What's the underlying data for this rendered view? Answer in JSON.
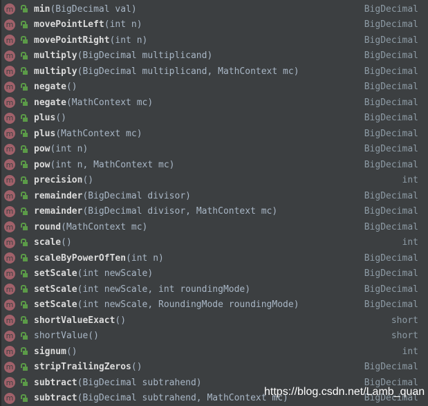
{
  "items": [
    {
      "name": "min",
      "params": "(BigDecimal val)",
      "ret": "BigDecimal"
    },
    {
      "name": "movePointLeft",
      "params": "(int n)",
      "ret": "BigDecimal"
    },
    {
      "name": "movePointRight",
      "params": "(int n)",
      "ret": "BigDecimal"
    },
    {
      "name": "multiply",
      "params": "(BigDecimal multiplicand)",
      "ret": "BigDecimal"
    },
    {
      "name": "multiply",
      "params": "(BigDecimal multiplicand, MathContext mc)",
      "ret": "BigDecimal"
    },
    {
      "name": "negate",
      "params": "()",
      "ret": "BigDecimal"
    },
    {
      "name": "negate",
      "params": "(MathContext mc)",
      "ret": "BigDecimal"
    },
    {
      "name": "plus",
      "params": "()",
      "ret": "BigDecimal"
    },
    {
      "name": "plus",
      "params": "(MathContext mc)",
      "ret": "BigDecimal"
    },
    {
      "name": "pow",
      "params": "(int n)",
      "ret": "BigDecimal"
    },
    {
      "name": "pow",
      "params": "(int n, MathContext mc)",
      "ret": "BigDecimal"
    },
    {
      "name": "precision",
      "params": "()",
      "ret": "int"
    },
    {
      "name": "remainder",
      "params": "(BigDecimal divisor)",
      "ret": "BigDecimal"
    },
    {
      "name": "remainder",
      "params": "(BigDecimal divisor, MathContext mc)",
      "ret": "BigDecimal"
    },
    {
      "name": "round",
      "params": "(MathContext mc)",
      "ret": "BigDecimal"
    },
    {
      "name": "scale",
      "params": "()",
      "ret": "int"
    },
    {
      "name": "scaleByPowerOfTen",
      "params": "(int n)",
      "ret": "BigDecimal"
    },
    {
      "name": "setScale",
      "params": "(int newScale)",
      "ret": "BigDecimal"
    },
    {
      "name": "setScale",
      "params": "(int newScale, int roundingMode)",
      "ret": "BigDecimal"
    },
    {
      "name": "setScale",
      "params": "(int newScale, RoundingMode roundingMode)",
      "ret": "BigDecimal"
    },
    {
      "name": "shortValueExact",
      "params": "()",
      "ret": "short"
    },
    {
      "name": "shortValue",
      "params": "()",
      "ret": "short",
      "plain": true
    },
    {
      "name": "signum",
      "params": "()",
      "ret": "int"
    },
    {
      "name": "stripTrailingZeros",
      "params": "()",
      "ret": "BigDecimal"
    },
    {
      "name": "subtract",
      "params": "(BigDecimal subtrahend)",
      "ret": "BigDecimal"
    },
    {
      "name": "subtract",
      "params": "(BigDecimal subtrahend, MathContext mc)",
      "ret": "BigDecimal"
    }
  ],
  "icon_letter": "m",
  "watermark": "https://blog.csdn.net/Lamb_quan",
  "colors": {
    "background": "#3c3f41",
    "method_icon": "#a1616a",
    "lock": "#5b9a48"
  }
}
